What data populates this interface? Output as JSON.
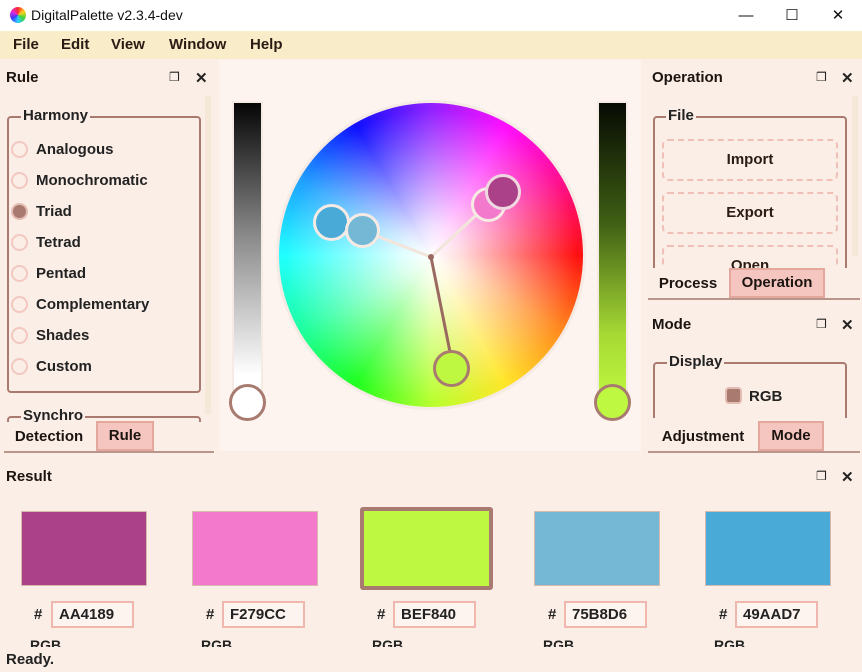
{
  "window": {
    "title": "DigitalPalette v2.3.4-dev",
    "controls": {
      "minimize": "—",
      "maximize": "☐",
      "close": "✕"
    }
  },
  "menu": [
    "File",
    "Edit",
    "View",
    "Window",
    "Help"
  ],
  "rule_panel": {
    "title": "Rule",
    "dock_icon": "❒",
    "close_icon": "✕",
    "harmony_legend": "Harmony",
    "options": [
      "Analogous",
      "Monochromatic",
      "Triad",
      "Tetrad",
      "Pentad",
      "Complementary",
      "Shades",
      "Custom"
    ],
    "selected": "Triad",
    "next_legend": "Synchro",
    "tabs": [
      "Detection",
      "Rule"
    ],
    "active_tab": "Rule"
  },
  "operation_panel": {
    "title": "Operation",
    "file_legend": "File",
    "buttons": [
      "Import",
      "Export",
      "Open"
    ],
    "tabs": [
      "Process",
      "Operation"
    ],
    "active_tab": "Operation"
  },
  "mode_panel": {
    "title": "Mode",
    "display_legend": "Display",
    "display_option": "RGB",
    "tabs": [
      "Adjustment",
      "Mode"
    ],
    "active_tab": "Mode"
  },
  "result_panel": {
    "title": "Result",
    "hash": "#",
    "rgb_label": "RGB",
    "colors": [
      {
        "hex": "AA4189",
        "color": "#AA4189"
      },
      {
        "hex": "F279CC",
        "color": "#F279CC"
      },
      {
        "hex": "BEF840",
        "color": "#BEF840",
        "selected": true
      },
      {
        "hex": "75B8D6",
        "color": "#75B8D6"
      },
      {
        "hex": "49AAD7",
        "color": "#49AAD7"
      }
    ]
  },
  "status": "Ready.",
  "colors": {
    "accent": "#a87a70",
    "tab_active": "#f5c6bf",
    "panel_bg": "#fbeee6",
    "menu_bg": "#f9ecc8"
  }
}
